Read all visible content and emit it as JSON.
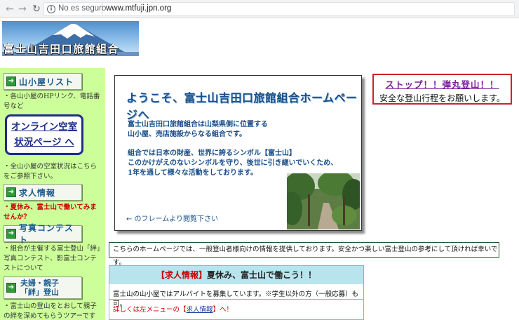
{
  "browser": {
    "security_label": "No es seguro",
    "url": "www.mtfuji.jpn.org"
  },
  "header": {
    "logo_text": "富士山吉田口旅館組合"
  },
  "sidebar": {
    "hut_list_label": "山小屋リスト",
    "hut_list_note": "・各山小屋のHPリンク、電話番号など",
    "online_line1": "オンライン空室",
    "online_line2": "状況ページ へ",
    "online_note": "・全山小屋の空室状況はこちらをご参照下さい。",
    "job_label": "求人情報",
    "job_note": "・夏休み、富士山で働いてみませんか？",
    "photo_label": "写真コンテスト",
    "photo_note": "・組合が主催する富士登山「絆」写真コンテスト、影富士コンテストについて",
    "duo_line1": "夫婦・親子",
    "duo_line2": "「絆」登山",
    "duo_note": "・富士山の登山をとおして親子の絆を深めてもらうツアーです"
  },
  "welcome": {
    "title": "ようこそ、富士山吉田口旅館組合ホームページへ",
    "p1_line1": "富士山吉田口旅館組合は山梨県側に位置する",
    "p1_line2": "山小屋、売店施設からなる組合です。",
    "p2_line1": "組合では日本の財産、世界に誇るシンボル【富士山】",
    "p2_line2": "このかけがえのないシンボルを守り、後世に引き継いでいくため、",
    "p2_line3": "1年を通して様々な活動をしております。",
    "frame_note": "← のフレームより閲覧下さい"
  },
  "stop_box": {
    "title": "ストップ！！弾丸登山！！",
    "subtitle": "安全な登山行程をお願いします。"
  },
  "description": "こちらのホームページでは、一般登山者様向けの情報を提供しております。安全かつ楽しい富士登山の参考にして頂ければ幸いです。",
  "job_box": {
    "tag": "【求人情報】",
    "headline": "夏休み、富士山で働こう！！",
    "body": "富士山の山小屋ではアルバイトを募集しています。※学生以外の方（一般応募）も可。",
    "link_prefix": "詳しくは左メニューの【",
    "link_text": "求人情報",
    "link_suffix": "】へ！"
  },
  "colors": {
    "sidebar_bg": "#ccff99",
    "title_blue": "#1a4f8a",
    "stop_border": "#cc2233",
    "job_head_bg": "#b8e4ee"
  }
}
